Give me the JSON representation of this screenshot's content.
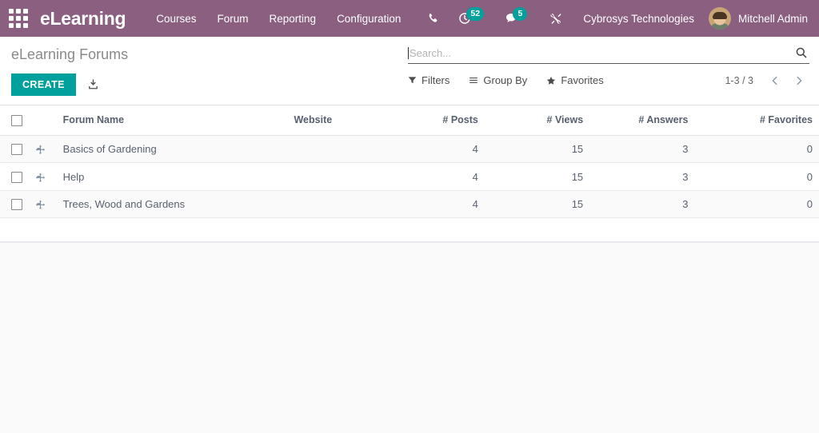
{
  "theme": {
    "navbar_bg": "#8A5F7F",
    "accent": "#00A09D",
    "badge_bg": "#00A09D",
    "text_muted": "#8a8a8a"
  },
  "navbar": {
    "apps_icon": "apps-grid-icon",
    "brand": "eLearning",
    "menu": [
      {
        "label": "Courses"
      },
      {
        "label": "Forum"
      },
      {
        "label": "Reporting"
      },
      {
        "label": "Configuration"
      }
    ],
    "systray": {
      "phone_icon": "phone-icon",
      "activities_icon": "clock-activities-icon",
      "activities_count": "52",
      "messages_icon": "messages-icon",
      "messages_count": "5",
      "debug_icon": "debug-tools-icon"
    },
    "company": "Cybrosys Technologies",
    "user": {
      "name": "Mitchell Admin",
      "avatar_icon": "user-avatar"
    }
  },
  "control_panel": {
    "breadcrumb": "eLearning Forums",
    "create_label": "CREATE",
    "import_icon": "import-icon",
    "search": {
      "placeholder": "Search...",
      "value": "",
      "search_icon": "search-icon"
    },
    "filters": [
      {
        "label": "Filters",
        "icon": "filter-icon"
      },
      {
        "label": "Group By",
        "icon": "group-by-icon"
      },
      {
        "label": "Favorites",
        "icon": "star-icon"
      }
    ],
    "pager": {
      "range": "1-3 / 3",
      "prev_icon": "chevron-left-icon",
      "next_icon": "chevron-right-icon"
    }
  },
  "list": {
    "columns": [
      {
        "label": "Forum Name",
        "align": "left"
      },
      {
        "label": "Website",
        "align": "left"
      },
      {
        "label": "# Posts",
        "align": "right"
      },
      {
        "label": "# Views",
        "align": "right"
      },
      {
        "label": "# Answers",
        "align": "right"
      },
      {
        "label": "# Favorites",
        "align": "right"
      }
    ],
    "rows": [
      {
        "forum_name": "Basics of Gardening",
        "website": "",
        "posts": "4",
        "views": "15",
        "answers": "3",
        "favorites": "0"
      },
      {
        "forum_name": "Help",
        "website": "",
        "posts": "4",
        "views": "15",
        "answers": "3",
        "favorites": "0"
      },
      {
        "forum_name": "Trees, Wood and Gardens",
        "website": "",
        "posts": "4",
        "views": "15",
        "answers": "3",
        "favorites": "0"
      }
    ]
  }
}
